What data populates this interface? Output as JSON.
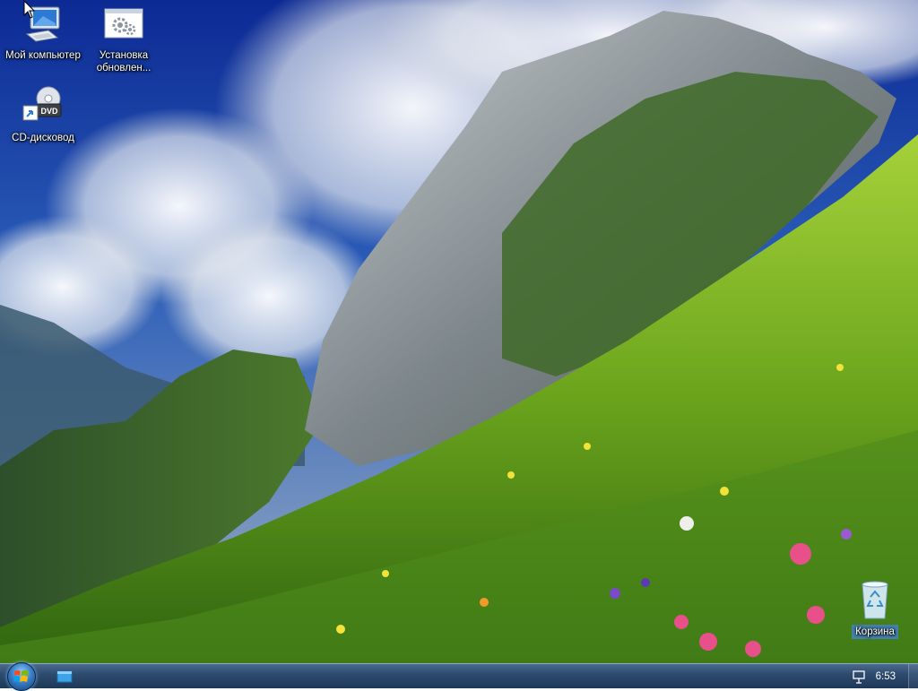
{
  "desktop": {
    "icons": [
      {
        "label": "Мой компьютер",
        "icon": "computer-icon"
      },
      {
        "label": "Установка обновлен...",
        "icon": "installer-icon"
      },
      {
        "label": "CD-дисковод",
        "icon": "dvd-drive-icon",
        "badge": "DVD"
      },
      {
        "label": "Корзина",
        "icon": "recycle-bin-icon"
      }
    ]
  },
  "taskbar": {
    "clock": "6:53",
    "start_icon": "windows-logo-icon",
    "pinned_icon": "show-desktop-window-icon",
    "tray_icon": "action-center-flag-icon"
  },
  "colors": {
    "taskbar_top": "#4a6a8e",
    "taskbar_bottom": "#1d3858",
    "selection": "#4682c8"
  }
}
